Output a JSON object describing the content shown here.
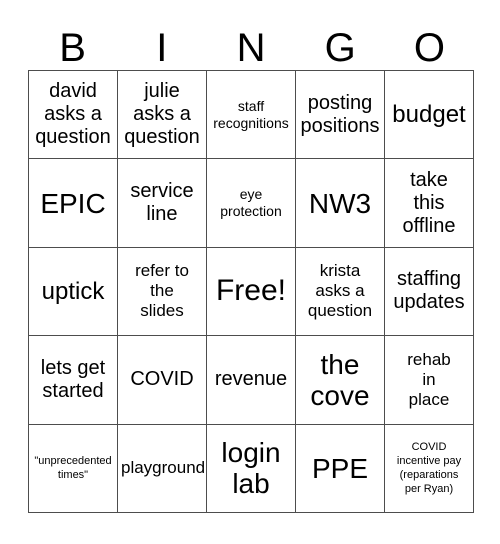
{
  "card": {
    "title": "BINGO",
    "header_letters": [
      "B",
      "I",
      "N",
      "G",
      "O"
    ],
    "free_space_label": "Free!",
    "colors": {
      "background": "#ffffff",
      "text": "#000000",
      "grid_line": "#4d4d4d"
    },
    "rows": [
      [
        {
          "text": "david\nasks a\nquestion",
          "size": "md"
        },
        {
          "text": "julie\nasks a\nquestion",
          "size": "md"
        },
        {
          "text": "staff\nrecognitions",
          "size": "xs"
        },
        {
          "text": "posting\npositions",
          "size": "md"
        },
        {
          "text": "budget",
          "size": "lg"
        }
      ],
      [
        {
          "text": "EPIC",
          "size": "xl"
        },
        {
          "text": "service\nline",
          "size": "md"
        },
        {
          "text": "eye\nprotection",
          "size": "xs"
        },
        {
          "text": "NW3",
          "size": "xl"
        },
        {
          "text": "take\nthis\noffline",
          "size": "md"
        }
      ],
      [
        {
          "text": "uptick",
          "size": "lg"
        },
        {
          "text": "refer to\nthe\nslides",
          "size": "sm"
        },
        {
          "text": "Free!",
          "size": "xxl"
        },
        {
          "text": "krista\nasks a\nquestion",
          "size": "sm"
        },
        {
          "text": "staffing\nupdates",
          "size": "md"
        }
      ],
      [
        {
          "text": "lets get\nstarted",
          "size": "md"
        },
        {
          "text": "COVID",
          "size": "md"
        },
        {
          "text": "revenue",
          "size": "md"
        },
        {
          "text": "the\ncove",
          "size": "xl"
        },
        {
          "text": "rehab\nin\nplace",
          "size": "sm"
        }
      ],
      [
        {
          "text": "\"unprecedented\ntimes\"",
          "size": "xxs"
        },
        {
          "text": "playground",
          "size": "sm"
        },
        {
          "text": "login\nlab",
          "size": "xl"
        },
        {
          "text": "PPE",
          "size": "xl"
        },
        {
          "text": "COVID\nincentive pay\n(reparations\nper Ryan)",
          "size": "xxs"
        }
      ]
    ]
  }
}
